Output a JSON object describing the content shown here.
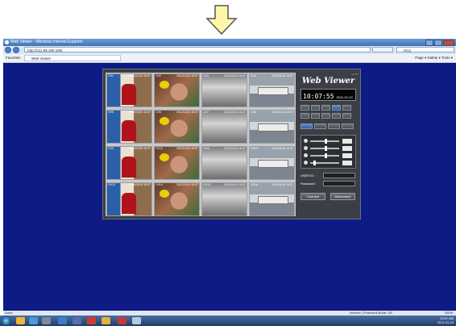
{
  "browser": {
    "title": "Web Viewer - Windows Internet Explorer",
    "address": "http://211.99.190.180/",
    "search_placeholder": "Bing",
    "favorites_label": "Favorites",
    "tab_label": "Web Viewer",
    "command_bar": "Page ▾  Safety ▾  Tools ▾"
  },
  "viewer": {
    "version": "V1.0.1",
    "title": "Web Viewer",
    "time": "10:07:55",
    "date": "2011-01-24",
    "cameras": [
      {
        "label": "CH1",
        "timestamp": "2011/01/24 10:07"
      },
      {
        "label": "CH2",
        "timestamp": "2011/01/24 10:07"
      },
      {
        "label": "CH3",
        "timestamp": "2011/01/24 10:07"
      },
      {
        "label": "CH4",
        "timestamp": "2011/01/24 10:07"
      },
      {
        "label": "CH5",
        "timestamp": "2011/01/24 10:07"
      },
      {
        "label": "CH6",
        "timestamp": "2011/01/24 10:07"
      },
      {
        "label": "CH7",
        "timestamp": "2011/01/24 10:07"
      },
      {
        "label": "CH8",
        "timestamp": "2011/01/24 10:07"
      },
      {
        "label": "CH9",
        "timestamp": "2011/01/24 10:07"
      },
      {
        "label": "CH10",
        "timestamp": "2011/01/24 10:07"
      },
      {
        "label": "CH11",
        "timestamp": "2011/01/24 10:07"
      },
      {
        "label": "CH12",
        "timestamp": "2011/01/24 10:07"
      },
      {
        "label": "CH13",
        "timestamp": "2011/01/24 10:07"
      },
      {
        "label": "CH14",
        "timestamp": "2011/01/24 10:07"
      },
      {
        "label": "CH15",
        "timestamp": "2011/01/24 10:07"
      },
      {
        "label": "CH16",
        "timestamp": "2011/01/24 10:07"
      }
    ],
    "user_id_label": "USER ID :",
    "password_label": "Password :",
    "connect_label": "Connect",
    "disconnect_label": "Disconnect"
  },
  "status": {
    "left": "Done",
    "zone": "Internet | Protected Mode: Off",
    "zoom": "100%"
  },
  "taskbar": {
    "clock_time": "10:07 AM",
    "clock_date": "2011-01-24"
  }
}
